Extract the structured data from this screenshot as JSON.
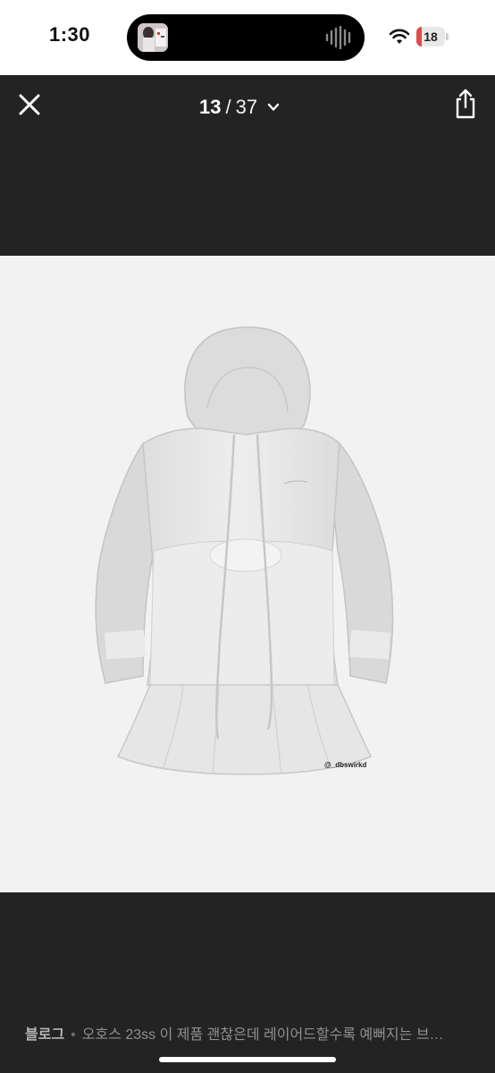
{
  "status_bar": {
    "time": "1:30",
    "battery_level": "18",
    "battery_fraction": 0.18,
    "battery_color": "#e24a4a",
    "island_thumbnail_icon": "album-art-thumbnail",
    "island_waveform_icon": "audio-waveform-icon",
    "wifi_icon": "wifi-icon"
  },
  "viewer": {
    "current": "13",
    "separator": "/",
    "total": "37",
    "close_icon": "close-icon",
    "dropdown_icon": "chevron-down-icon",
    "share_icon": "share-icon",
    "background_color": "#232323"
  },
  "photo": {
    "watermark": "@_dbswirkd",
    "background_color": "#f2f2f2",
    "subject": "white-hooded-mini-dress"
  },
  "caption": {
    "source": "블로그",
    "text": "오호스 23ss 이 제품 괜찮은데 레이어드할수록 예뻐지는 브…"
  }
}
